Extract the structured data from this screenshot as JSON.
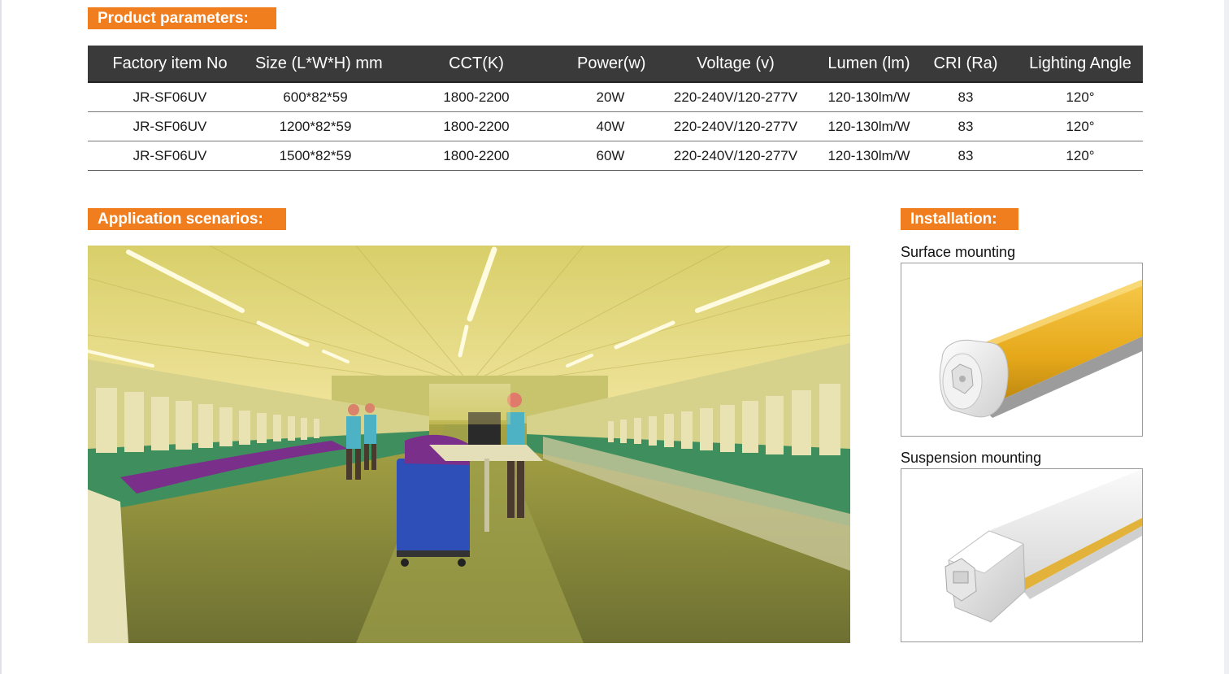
{
  "sections": {
    "product_parameters": "Product parameters:",
    "application_scenarios": "Application scenarios:",
    "installation": "Installation:"
  },
  "table": {
    "headers": [
      "Factory item No",
      "Size (L*W*H) mm",
      "CCT(K)",
      "Power(w)",
      "Voltage (v)",
      "Lumen (lm)",
      "CRI (Ra)",
      "Lighting Angle"
    ],
    "rows": [
      [
        "JR-SF06UV",
        "600*82*59",
        "1800-2200",
        "20W",
        "220-240V/120-277V",
        "120-130lm/W",
        "83",
        "120°"
      ],
      [
        "JR-SF06UV",
        "1200*82*59",
        "1800-2200",
        "40W",
        "220-240V/120-277V",
        "120-130lm/W",
        "83",
        "120°"
      ],
      [
        "JR-SF06UV",
        "1500*82*59",
        "1800-2200",
        "60W",
        "220-240V/120-277V",
        "120-130lm/W",
        "83",
        "120°"
      ]
    ]
  },
  "installation": {
    "surface_label": "Surface mounting",
    "suspension_label": "Suspension mounting"
  },
  "colors": {
    "accent_orange": "#f07d1e",
    "table_header_bg": "#3a3a3a",
    "tube_amber": "#f0b41e"
  }
}
